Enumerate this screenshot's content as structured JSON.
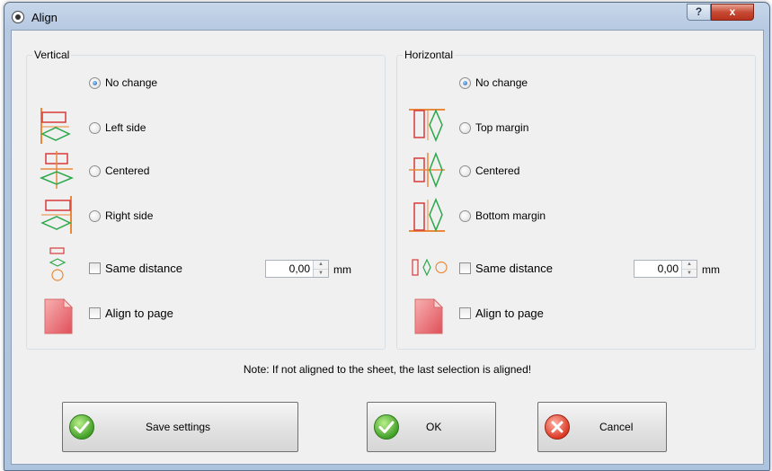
{
  "window": {
    "title": "Align",
    "help_glyph": "?",
    "close_glyph": "x"
  },
  "vertical": {
    "legend": "Vertical",
    "options": [
      {
        "label": "No change",
        "icon": "none",
        "selected": true
      },
      {
        "label": "Left side",
        "icon": "align-left-icon",
        "selected": false
      },
      {
        "label": "Centered",
        "icon": "align-center-v-icon",
        "selected": false
      },
      {
        "label": "Right side",
        "icon": "align-right-icon",
        "selected": false
      }
    ],
    "same_distance": {
      "label": "Same distance",
      "checked": false,
      "value": "0,00",
      "unit": "mm"
    },
    "align_to_page": {
      "label": "Align to page",
      "checked": false
    }
  },
  "horizontal": {
    "legend": "Horizontal",
    "options": [
      {
        "label": "No change",
        "icon": "none",
        "selected": true
      },
      {
        "label": "Top margin",
        "icon": "align-top-icon",
        "selected": false
      },
      {
        "label": "Centered",
        "icon": "align-center-h-icon",
        "selected": false
      },
      {
        "label": "Bottom margin",
        "icon": "align-bottom-icon",
        "selected": false
      }
    ],
    "same_distance": {
      "label": "Same distance",
      "checked": false,
      "value": "0,00",
      "unit": "mm"
    },
    "align_to_page": {
      "label": "Align to page",
      "checked": false
    }
  },
  "note": "Note: If not aligned to the sheet, the last selection is aligned!",
  "buttons": {
    "save": {
      "label": "Save settings",
      "icon": "green-check-icon"
    },
    "ok": {
      "label": "OK",
      "icon": "green-check-icon"
    },
    "cancel": {
      "label": "Cancel",
      "icon": "red-x-icon"
    }
  },
  "colors": {
    "shape_red": "#d83a3a",
    "shape_orange": "#e9893a",
    "shape_green": "#2aa84a"
  }
}
